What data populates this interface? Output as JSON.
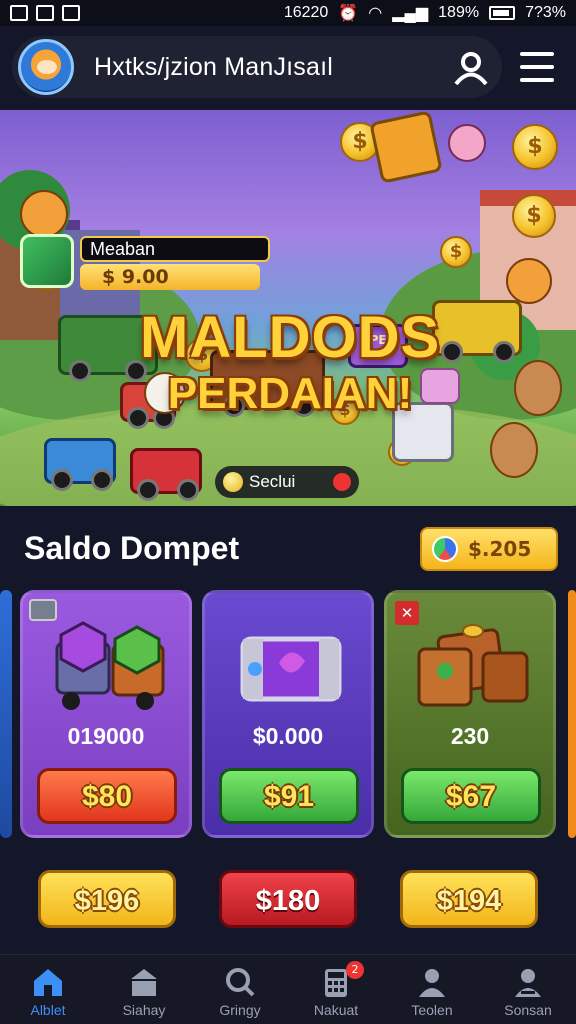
{
  "status_bar": {
    "time": "16220",
    "battery": "189%",
    "clock_right": "7?3%"
  },
  "header": {
    "title": "Hxtks/jzion ManJısaıl",
    "profile_icon": "user-icon",
    "menu_icon": "hamburger-menu-icon"
  },
  "banner": {
    "title_line1": "MALDODS",
    "title_line2": "PERDAIAN!",
    "balance_label": "Meaban",
    "balance_value": "$ 9.00",
    "pill_label": "Seclui",
    "sign_text": "OPEN"
  },
  "wallet": {
    "title": "Saldo Dompet",
    "total": "$.205",
    "cards": [
      {
        "value": "019000",
        "button": "$80",
        "color": "#8a4fd0"
      },
      {
        "value": "$0.000",
        "button": "$91",
        "color": "#5b3bbd"
      },
      {
        "value": "230",
        "button": "$67",
        "color": "#557a2e"
      }
    ],
    "bottom_buttons": [
      {
        "label": "$196"
      },
      {
        "label": "$180"
      },
      {
        "label": "$194"
      }
    ]
  },
  "nav": {
    "items": [
      {
        "label": "Alblet",
        "icon": "home-icon"
      },
      {
        "label": "Siahay",
        "icon": "store-icon"
      },
      {
        "label": "Gringy",
        "icon": "search-icon"
      },
      {
        "label": "Nakuat",
        "icon": "calculator-icon",
        "badge": "2"
      },
      {
        "label": "Teolen",
        "icon": "person-icon"
      },
      {
        "label": "Sonsan",
        "icon": "profile-icon"
      }
    ]
  },
  "colors": {
    "accent": "#3e8ff5",
    "btn_red": "#e8452c",
    "btn_green": "#4cc24a",
    "btn_yellow": "#f6c21e"
  }
}
